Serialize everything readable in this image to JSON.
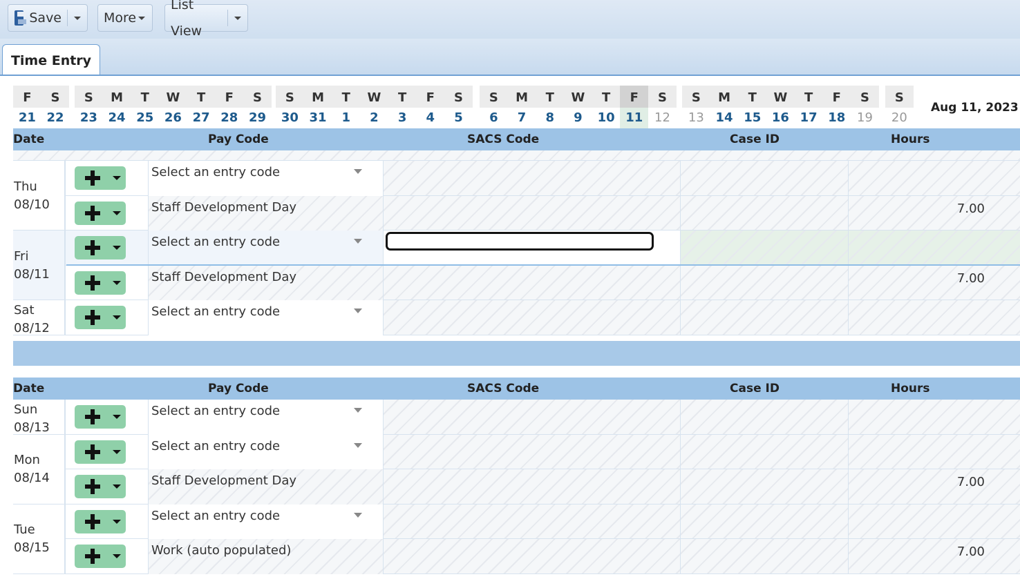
{
  "toolbar": {
    "save_label": "Save",
    "more_label": "More",
    "listview_label": "List View"
  },
  "tabs": [
    {
      "label": "Time Entry",
      "active": true
    }
  ],
  "calendar": {
    "weeks": [
      {
        "days": [
          {
            "dow": "F",
            "num": "21"
          },
          {
            "dow": "S",
            "num": "22"
          }
        ]
      },
      {
        "days": [
          {
            "dow": "S",
            "num": "23"
          },
          {
            "dow": "M",
            "num": "24"
          },
          {
            "dow": "T",
            "num": "25"
          },
          {
            "dow": "W",
            "num": "26"
          },
          {
            "dow": "T",
            "num": "27"
          },
          {
            "dow": "F",
            "num": "28"
          },
          {
            "dow": "S",
            "num": "29"
          }
        ]
      },
      {
        "days": [
          {
            "dow": "S",
            "num": "30"
          },
          {
            "dow": "M",
            "num": "31"
          },
          {
            "dow": "T",
            "num": "1"
          },
          {
            "dow": "W",
            "num": "2"
          },
          {
            "dow": "T",
            "num": "3"
          },
          {
            "dow": "F",
            "num": "4"
          },
          {
            "dow": "S",
            "num": "5"
          }
        ]
      },
      {
        "days": [
          {
            "dow": "S",
            "num": "6"
          },
          {
            "dow": "M",
            "num": "7"
          },
          {
            "dow": "T",
            "num": "8"
          },
          {
            "dow": "W",
            "num": "9"
          },
          {
            "dow": "T",
            "num": "10"
          },
          {
            "dow": "F",
            "num": "11",
            "selected": true
          },
          {
            "dow": "S",
            "num": "12",
            "dim": true
          }
        ]
      },
      {
        "days": [
          {
            "dow": "S",
            "num": "13",
            "dim": true
          },
          {
            "dow": "M",
            "num": "14"
          },
          {
            "dow": "T",
            "num": "15"
          },
          {
            "dow": "W",
            "num": "16"
          },
          {
            "dow": "T",
            "num": "17"
          },
          {
            "dow": "F",
            "num": "18"
          },
          {
            "dow": "S",
            "num": "19",
            "dim": true
          }
        ]
      },
      {
        "days": [
          {
            "dow": "S",
            "num": "20",
            "dim": true
          }
        ]
      }
    ],
    "current_date": "Aug 11, 2023"
  },
  "columns": {
    "date": "Date",
    "pay_code": "Pay Code",
    "sacs_code": "SACS Code",
    "case_id": "Case ID",
    "hours": "Hours"
  },
  "week1": {
    "days": [
      {
        "dow": "Thu",
        "date": "08/10",
        "entries": [
          {
            "pay_code": "Select an entry code",
            "hours": ""
          },
          {
            "pay_code": "Staff Development Day",
            "hours": "7.00"
          }
        ]
      },
      {
        "dow": "Fri",
        "date": "08/11",
        "entries": [
          {
            "pay_code": "Select an entry code",
            "hours": "",
            "editing": true
          },
          {
            "pay_code": "Staff Development Day",
            "hours": "7.00"
          }
        ]
      },
      {
        "dow": "Sat",
        "date": "08/12",
        "entries": [
          {
            "pay_code": "Select an entry code",
            "hours": ""
          }
        ]
      }
    ]
  },
  "week2": {
    "days": [
      {
        "dow": "Sun",
        "date": "08/13",
        "entries": [
          {
            "pay_code": "Select an entry code",
            "hours": ""
          }
        ]
      },
      {
        "dow": "Mon",
        "date": "08/14",
        "entries": [
          {
            "pay_code": "Select an entry code",
            "hours": ""
          },
          {
            "pay_code": "Staff Development Day",
            "hours": "7.00"
          }
        ]
      },
      {
        "dow": "Tue",
        "date": "08/15",
        "entries": [
          {
            "pay_code": "Select an entry code",
            "hours": ""
          },
          {
            "pay_code": "Work (auto populated)",
            "hours": "7.00"
          }
        ]
      }
    ]
  }
}
